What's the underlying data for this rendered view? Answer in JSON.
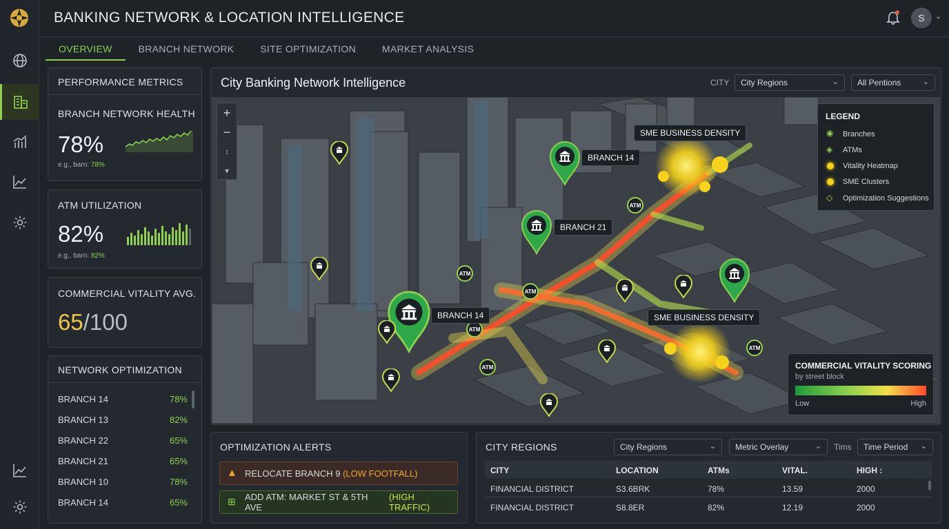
{
  "app": {
    "title": "BANKING NETWORK & LOCATION INTELLIGENCE",
    "avatar_initial": "S"
  },
  "tabs": [
    "OVERVIEW",
    "BRANCH NETWORK",
    "SITE OPTIMIZATION",
    "MARKET ANALYSIS"
  ],
  "metrics": {
    "title": "PERFORMANCE METRICS",
    "health": {
      "label": "BRANCH NETWORK HEALTH",
      "value": "78%",
      "sub_key": "e.g., barn:",
      "sub_val": "78%"
    },
    "atm": {
      "label": "ATM UTILIZATION",
      "value": "82%",
      "sub_key": "e.g., barn:",
      "sub_val": "82%"
    },
    "vitality": {
      "label": "COMMERCIAL VITALITY AVG.",
      "value": "65",
      "max": "/100"
    }
  },
  "network_opt": {
    "title": "NETWORK OPTIMIZATION",
    "rows": [
      {
        "name": "BRANCH 14",
        "value": "78%"
      },
      {
        "name": "BRANCH 13",
        "value": "82%"
      },
      {
        "name": "BRANCH 22",
        "value": "65%"
      },
      {
        "name": "BRANCH 21",
        "value": "65%"
      },
      {
        "name": "BRANCH 10",
        "value": "78%"
      },
      {
        "name": "BRANCH 14",
        "value": "65%"
      }
    ]
  },
  "map_panel": {
    "title": "City Banking Network Intelligence",
    "city_label": "CITY",
    "city_select": "City Regions",
    "pentions_select": "All Pentions",
    "labels": {
      "branch14a": "BRANCH 14",
      "branch21": "BRANCH 21",
      "branch14b": "BRANCH 14",
      "sme1": "SME BUSINESS DENSITY",
      "sme2": "SME BUSINESS DENSITY"
    },
    "atm_text": "ATM",
    "legend": {
      "title": "LEGEND",
      "items": [
        "Branches",
        "ATMs",
        "Vitality Heatmap",
        "SME Clusters",
        "Optimization Suggestions"
      ]
    },
    "scoring": {
      "title": "COMMERCIAL VITALITY SCORING",
      "subtitle": "by street block",
      "low": "Low",
      "high": "High"
    },
    "zoom_in": "+",
    "zoom_out": "−"
  },
  "alerts": {
    "title": "OPTIMIZATION ALERTS",
    "a1_text": "RELOCATE BRANCH 9",
    "a1_note": "(LOW FOOTFALL)",
    "a2_text": "ADD ATM: MARKET ST & 5TH AVE",
    "a2_note": "(HIGH TRAFFIC)"
  },
  "regions": {
    "title": "CITY REGIONS",
    "select1": "City Regions",
    "select2": "Metric Overlay",
    "tims_label": "Tims",
    "select3": "Time Period",
    "columns": [
      "CITY",
      "LOCATION",
      "ATMs",
      "VITAL.",
      "HIGH :"
    ],
    "rows": [
      [
        "FINANCIAL DISTRICT",
        "S3.6BRK",
        "78%",
        "13.59",
        "2000"
      ],
      [
        "FINANCIAL DISTRICT",
        "S8.8ER",
        "82%",
        "12.19",
        "2000"
      ]
    ]
  },
  "colors": {
    "accent": "#8fd14f",
    "warning": "#f0a830",
    "heat_low": "#2fbf4f",
    "heat_high": "#ff4a2a"
  }
}
